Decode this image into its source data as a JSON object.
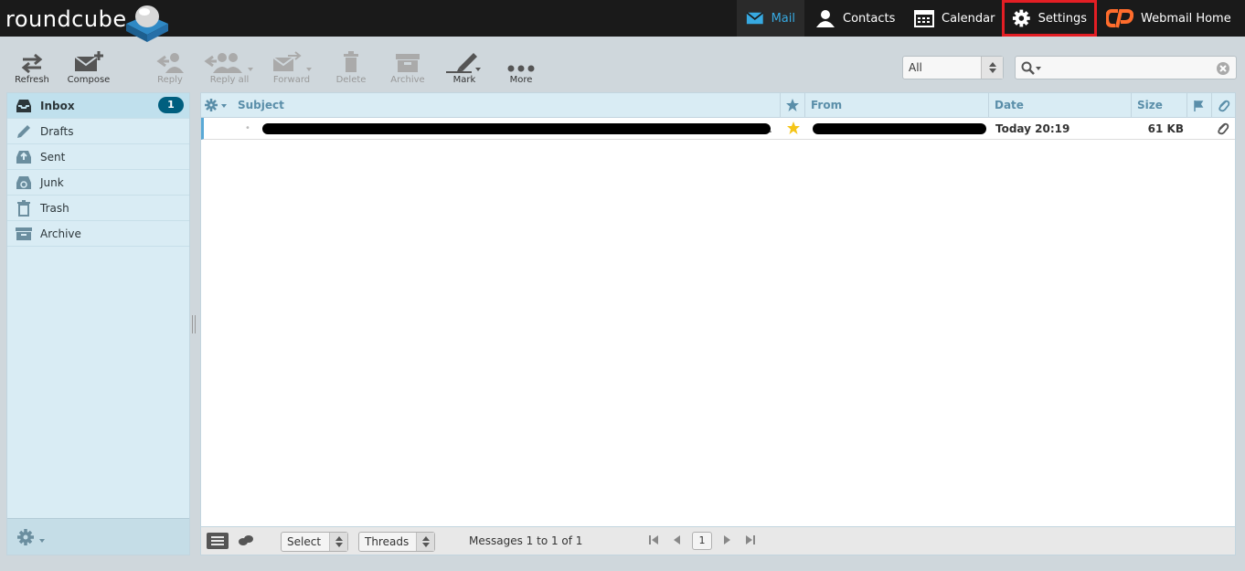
{
  "app": {
    "logo_text": "roundcube"
  },
  "topnav": {
    "mail": "Mail",
    "contacts": "Contacts",
    "calendar": "Calendar",
    "settings": "Settings",
    "webmail_home": "Webmail Home"
  },
  "toolbar": {
    "refresh": "Refresh",
    "compose": "Compose",
    "reply": "Reply",
    "reply_all": "Reply all",
    "forward": "Forward",
    "delete": "Delete",
    "archive": "Archive",
    "mark": "Mark",
    "more": "More"
  },
  "filter": {
    "value": "All"
  },
  "search": {
    "value": ""
  },
  "folders": [
    {
      "label": "Inbox",
      "unread": "1",
      "icon": "inbox-icon"
    },
    {
      "label": "Drafts",
      "icon": "pencil-icon"
    },
    {
      "label": "Sent",
      "icon": "sent-icon"
    },
    {
      "label": "Junk",
      "icon": "junk-icon"
    },
    {
      "label": "Trash",
      "icon": "trash-icon"
    },
    {
      "label": "Archive",
      "icon": "archive-icon"
    }
  ],
  "list": {
    "columns": {
      "subject": "Subject",
      "from": "From",
      "date": "Date",
      "size": "Size"
    },
    "rows": [
      {
        "date": "Today 20:19",
        "size": "61 KB",
        "flagged": true,
        "has_attachment": true
      }
    ]
  },
  "footer": {
    "select_label": "Select",
    "threads_label": "Threads",
    "count_text": "Messages 1 to 1 of 1",
    "page": "1"
  },
  "colors": {
    "accent": "#37a9e1",
    "highlight": "#e31e24",
    "star": "#f5c518"
  }
}
